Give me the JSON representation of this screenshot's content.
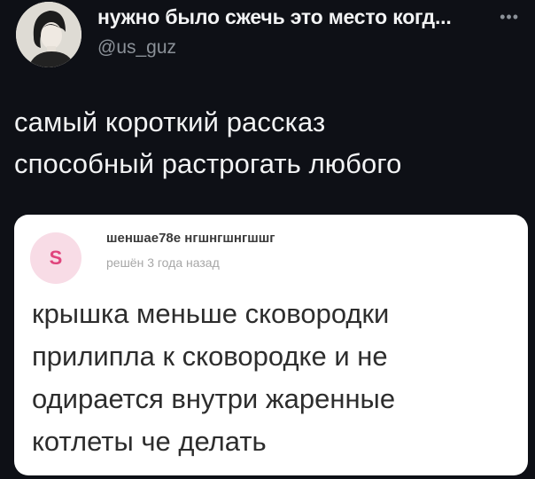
{
  "tweet": {
    "display_name": "нужно было сжечь это место когд...",
    "handle": "@us_guz",
    "more_icon": "more-dots-icon",
    "text_lines": [
      "самый короткий рассказ",
      "способный растрогать любого"
    ]
  },
  "card": {
    "avatar_letter": "S",
    "username": "шеншае78е нгшнгшнгшшг",
    "time": "решён 3 года назад",
    "question_lines": [
      "крышка меньше сковородки",
      "прилипла к сковородке и не",
      "одирается внутри жаренные",
      "котлеты че делать"
    ]
  },
  "colors": {
    "background": "#0e1016",
    "handle": "#8b9198",
    "card_background": "#ffffff",
    "card_avatar_bg": "#f8dce6",
    "card_avatar_letter": "#e0457d"
  }
}
